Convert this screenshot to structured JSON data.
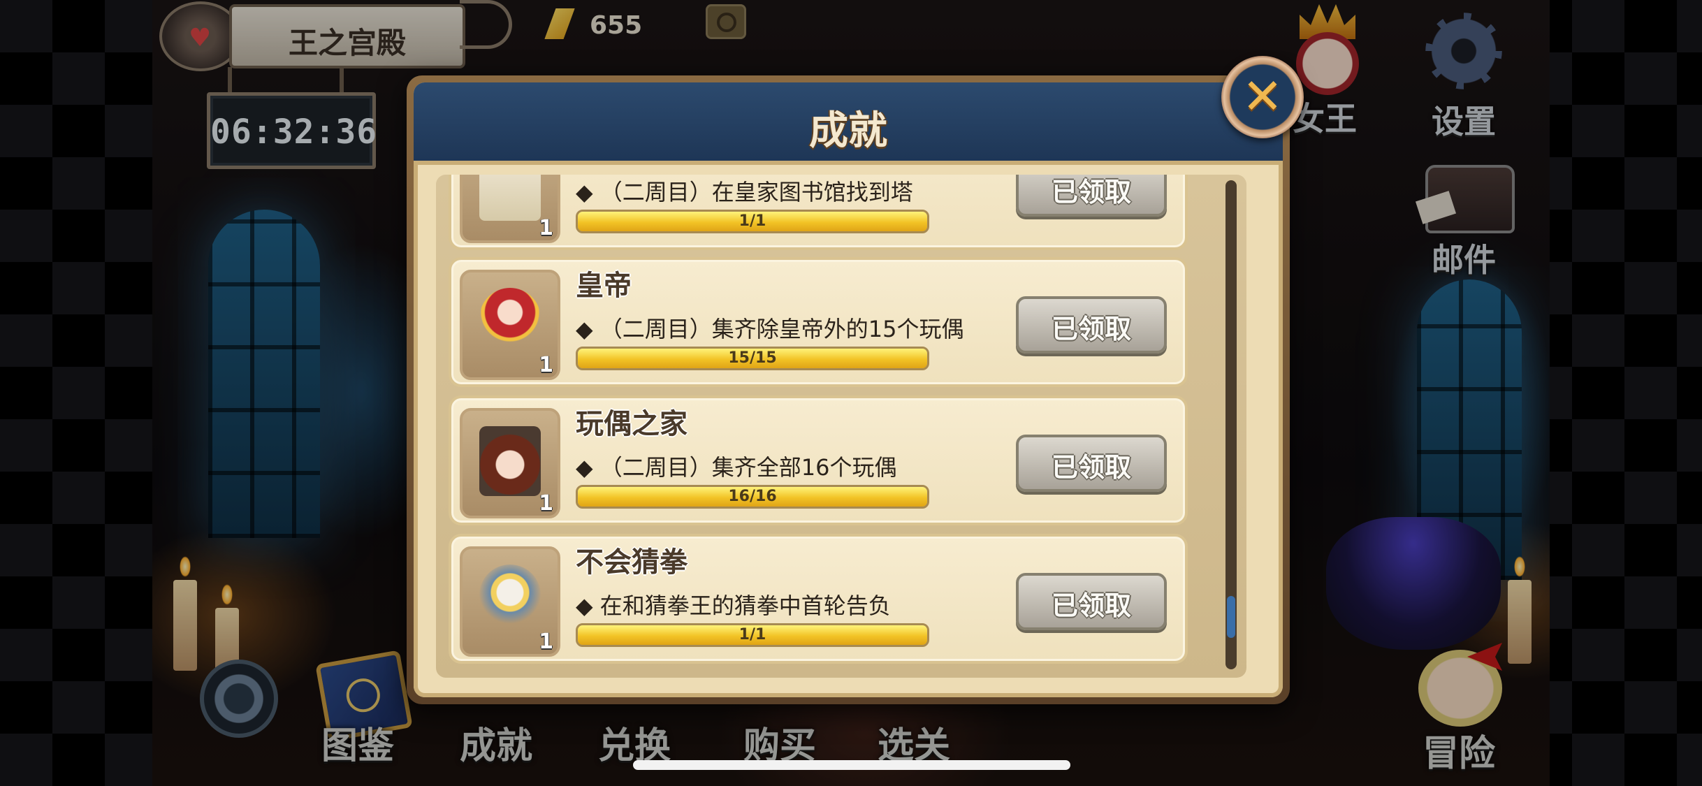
{
  "hud": {
    "location": "王之宫殿",
    "timer": "06:32:36",
    "gems": "655"
  },
  "side_menu": {
    "queen_label": "女王",
    "settings_label": "设置",
    "mail_label": "邮件"
  },
  "bottom_menu": {
    "items": [
      "图鉴",
      "成就",
      "兑换",
      "购买",
      "选关"
    ],
    "adventure_label": "冒险"
  },
  "dialog": {
    "title": "成就",
    "close_icon": "close-icon",
    "achievements": [
      {
        "name": "",
        "description": "◆ （二周目）在皇家图书馆找到塔",
        "progress_text": "1/1",
        "progress": 1.0,
        "count": "1",
        "button": "已领取",
        "icon": "map-paper"
      },
      {
        "name": "皇帝",
        "description": "◆ （二周目）集齐除皇帝外的15个玩偶",
        "progress_text": "15/15",
        "progress": 1.0,
        "count": "1",
        "button": "已领取",
        "icon": "emperor-doll"
      },
      {
        "name": "玩偶之家",
        "description": "◆ （二周目）集齐全部16个玩偶",
        "progress_text": "16/16",
        "progress": 1.0,
        "count": "1",
        "button": "已领取",
        "icon": "doll-girl"
      },
      {
        "name": "不会猜拳",
        "description": "◆ 在和猜拳王的猜拳中首轮告负",
        "progress_text": "1/1",
        "progress": 1.0,
        "count": "1",
        "button": "已领取",
        "icon": "puppet"
      }
    ],
    "scroll_position": 0.93
  },
  "colors": {
    "header": "#2c4a6e",
    "progress": "#f2c326",
    "claimed_button": "#a8a298"
  }
}
